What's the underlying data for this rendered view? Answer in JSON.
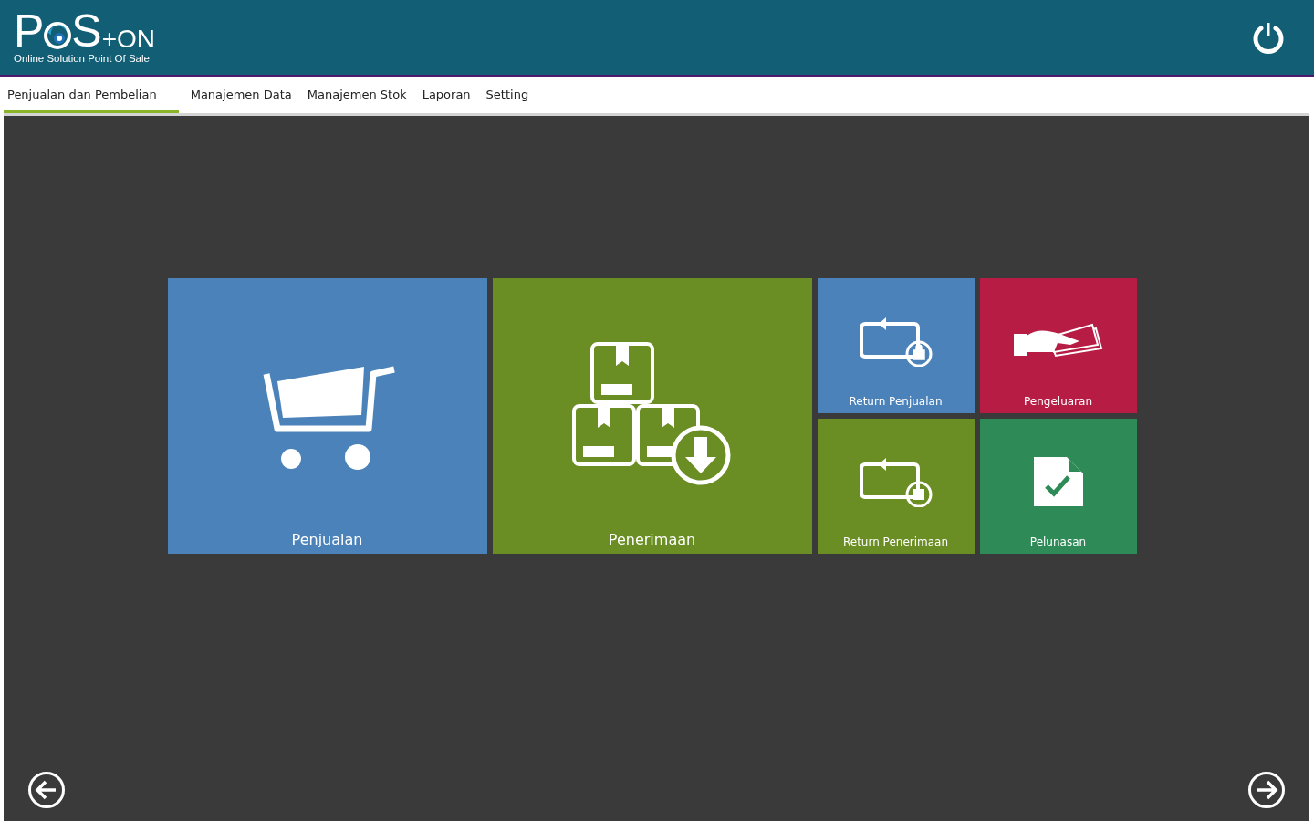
{
  "logo": {
    "first": "P",
    "second": "S",
    "suffix": "+ON",
    "tagline": "Online Solution Point Of Sale"
  },
  "tabs": [
    {
      "label": "Penjualan dan Pembelian",
      "selected": true
    },
    {
      "label": "Manajemen Data",
      "selected": false
    },
    {
      "label": "Manajemen Stok",
      "selected": false
    },
    {
      "label": "Laporan",
      "selected": false
    },
    {
      "label": "Setting",
      "selected": false
    }
  ],
  "large_tiles": [
    {
      "label": "Penjualan",
      "kind": "cart",
      "color": "#4a82b9"
    },
    {
      "label": "Penerimaan",
      "kind": "boxes",
      "color": "#6a8d24"
    }
  ],
  "small_tiles": [
    {
      "label": "Return Penjualan",
      "kind": "return-bag",
      "color": "#4a82b9"
    },
    {
      "label": "Pengeluaran",
      "kind": "money",
      "color": "#b71c44"
    },
    {
      "label": "Return Penerimaan",
      "kind": "return-barcode",
      "color": "#6a8d24"
    },
    {
      "label": "Pelunasan",
      "kind": "document",
      "color": "#2e8b57"
    }
  ]
}
